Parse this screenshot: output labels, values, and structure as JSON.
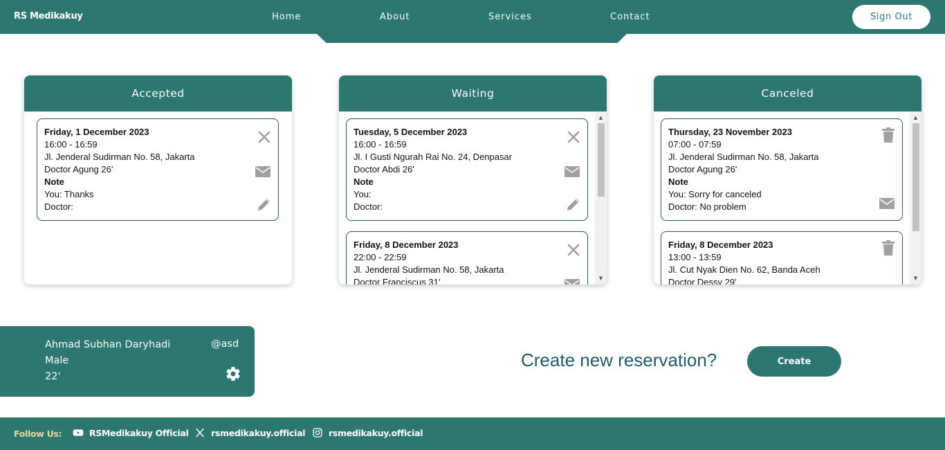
{
  "header": {
    "brand": "RS Medikakuy",
    "nav": [
      "Home",
      "About",
      "Services",
      "Contact"
    ],
    "signout_label": "Sign Out"
  },
  "columns": [
    {
      "title": "Accepted",
      "cards": [
        {
          "date": "Friday, 1 December 2023",
          "time": "16:00 - 16:59",
          "address": "Jl. Jenderal Sudirman No. 58, Jakarta",
          "doctor": "Doctor Agung 26'",
          "note_label": "Note",
          "you": "You: Thanks",
          "doctor_note": "Doctor:",
          "icons": [
            "close-icon",
            "mail-icon",
            "edit-icon"
          ]
        }
      ]
    },
    {
      "title": "Waiting",
      "cards": [
        {
          "date": "Tuesday, 5 December 2023",
          "time": "16:00 - 16:59",
          "address": "Jl. I Gusti Ngurah Rai No. 24, Denpasar",
          "doctor": "Doctor Abdi 26'",
          "note_label": "Note",
          "you": "You:",
          "doctor_note": "Doctor:",
          "icons": [
            "close-icon",
            "mail-icon",
            "edit-icon"
          ]
        },
        {
          "date": "Friday, 8 December 2023",
          "time": "22:00 - 22:59",
          "address": "Jl. Jenderal Sudirman No. 58, Jakarta",
          "doctor": "Doctor Franciscus 31'",
          "icons": [
            "close-icon",
            "mail-icon"
          ]
        }
      ]
    },
    {
      "title": "Canceled",
      "cards": [
        {
          "date": "Thursday, 23 November 2023",
          "time": "07:00 - 07:59",
          "address": "Jl. Jenderal Sudirman No. 58, Jakarta",
          "doctor": "Doctor Agung 26'",
          "note_label": "Note",
          "you": "You: Sorry for canceled",
          "doctor_note": "Doctor: No problem",
          "icons": [
            "trash-icon",
            "mail-icon"
          ]
        },
        {
          "date": "Friday, 8 December 2023",
          "time": "13:00 - 13:59",
          "address": "Jl. Cut Nyak Dien No. 62, Banda Aceh",
          "doctor": "Doctor Dessy 29'",
          "icons": [
            "trash-icon"
          ]
        }
      ]
    }
  ],
  "profile": {
    "name": "Ahmad Subhan Daryhadi",
    "gender": "Male",
    "age": "22'",
    "username": "@asd"
  },
  "create": {
    "question": "Create new reservation?",
    "button_label": "Create"
  },
  "footer": {
    "follow_label": "Follow Us:",
    "youtube": "RSMedikakuy Official",
    "x": "rsmedikakuy.official",
    "instagram": "rsmedikakuy.official"
  },
  "colors": {
    "primary": "#2d7771",
    "icon_gray": "#a0a0a0",
    "follow_accent": "#e8d9a0"
  }
}
